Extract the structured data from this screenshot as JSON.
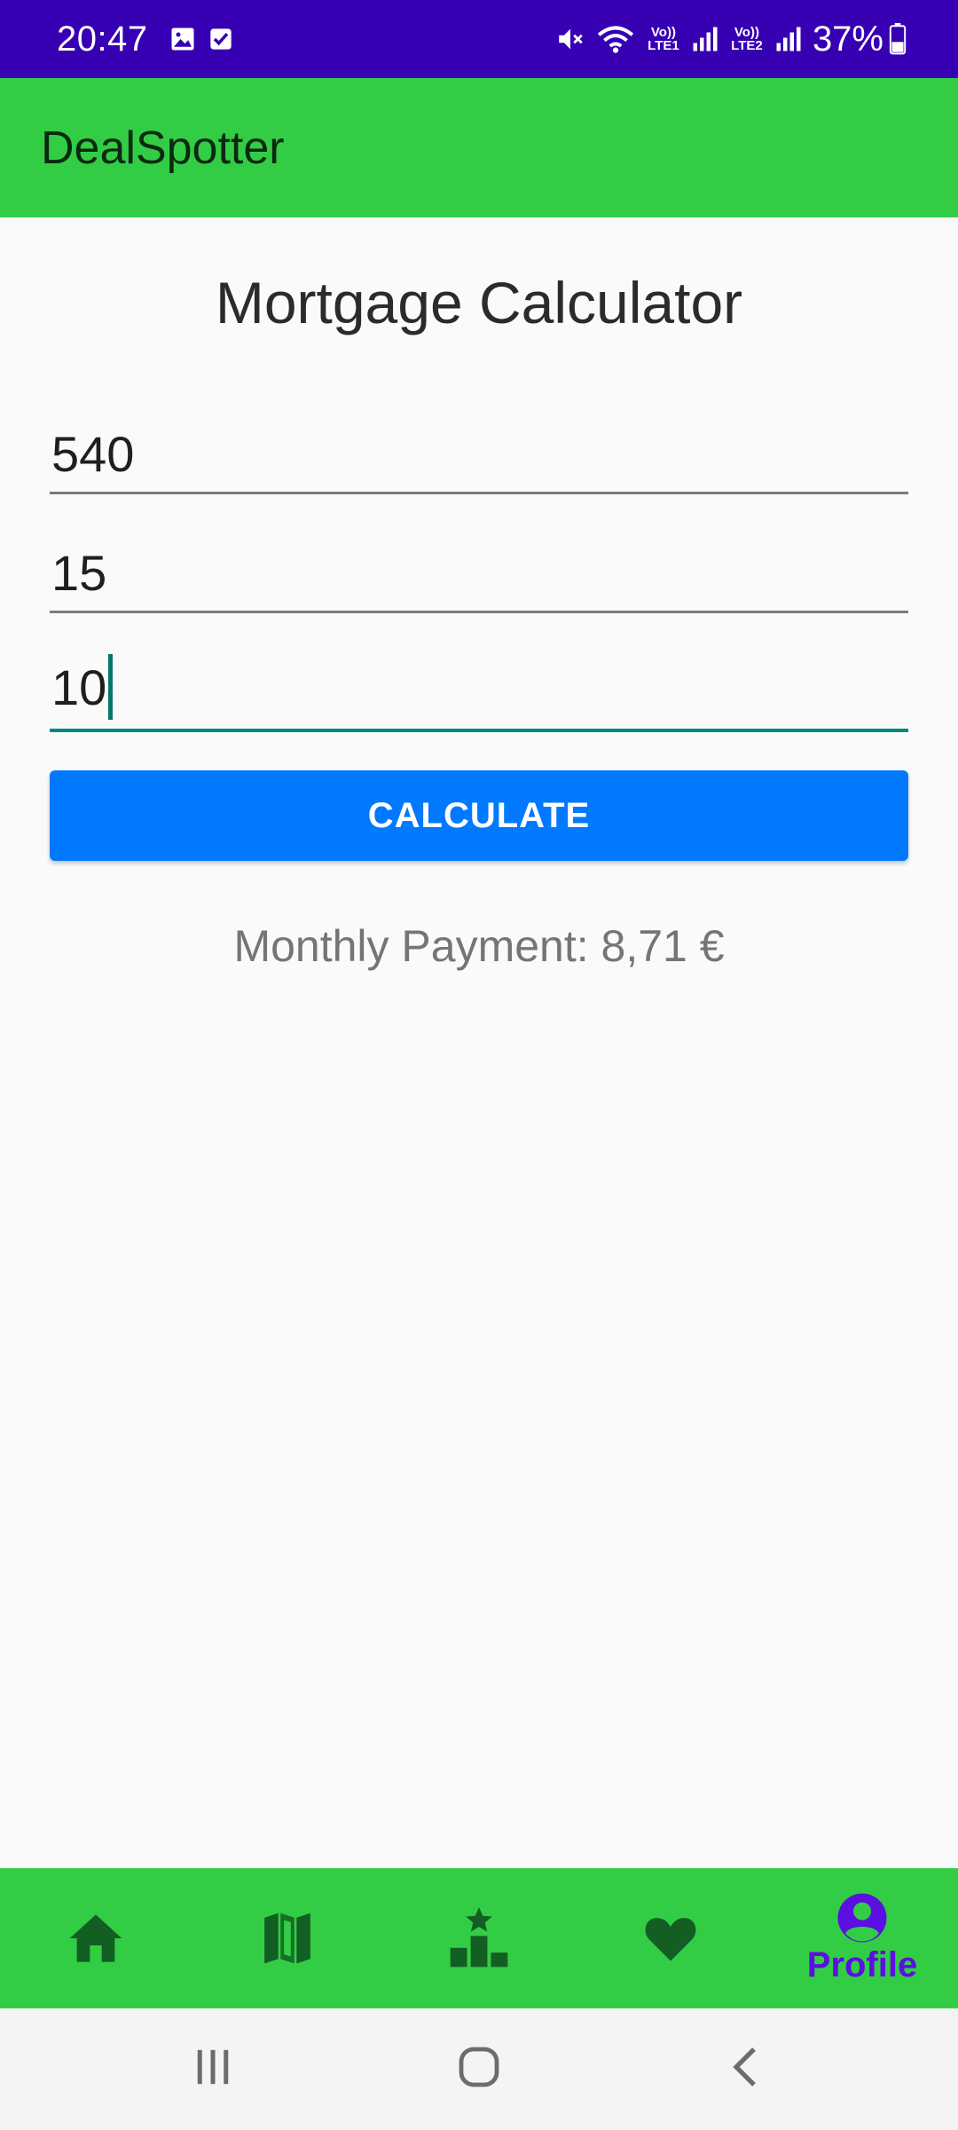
{
  "status_bar": {
    "time": "20:47",
    "battery": "37%",
    "sim1_label": "Vo)) LTE1",
    "sim2_label": "Vo)) LTE2",
    "icons": [
      "gallery-icon",
      "checkbox-icon",
      "mute-icon",
      "wifi-icon",
      "signal-icon",
      "battery-icon"
    ]
  },
  "app_bar": {
    "title": "DealSpotter"
  },
  "calculator": {
    "title": "Mortgage Calculator",
    "fields": [
      {
        "value": "540"
      },
      {
        "value": "15"
      },
      {
        "value": "10"
      }
    ],
    "button_label": "CALCULATE",
    "result": "Monthly Payment: 8,71 €"
  },
  "bottom_nav": {
    "items": [
      {
        "icon": "home-icon",
        "label": ""
      },
      {
        "icon": "map-icon",
        "label": ""
      },
      {
        "icon": "leaderboard-icon",
        "label": ""
      },
      {
        "icon": "heart-icon",
        "label": ""
      },
      {
        "icon": "profile-icon",
        "label": "Profile"
      }
    ],
    "active_index": 4
  },
  "colors": {
    "status_bar": "#3700b3",
    "app_bar": "#32cd45",
    "nav_icon": "#135e22",
    "nav_active": "#5b0fe0",
    "button": "#0079ff",
    "focus_underline": "#00897b"
  }
}
